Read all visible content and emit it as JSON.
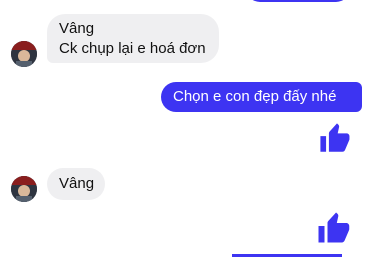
{
  "conversation": {
    "messages": [
      {
        "sender": "contact",
        "lines": [
          "Vâng",
          "Ck chụp lại e hoá đơn"
        ]
      },
      {
        "sender": "me",
        "lines": [
          "Chọn e con đẹp đấy nhé"
        ]
      },
      {
        "sender": "me",
        "type": "like",
        "icon": "thumbs-up-icon"
      },
      {
        "sender": "contact",
        "lines": [
          "Vâng"
        ]
      },
      {
        "sender": "me",
        "type": "like",
        "icon": "thumbs-up-icon"
      }
    ]
  },
  "colors": {
    "outgoing_bubble": "#3d34f2",
    "incoming_bubble": "#efeff1",
    "like": "#3d34f2"
  }
}
